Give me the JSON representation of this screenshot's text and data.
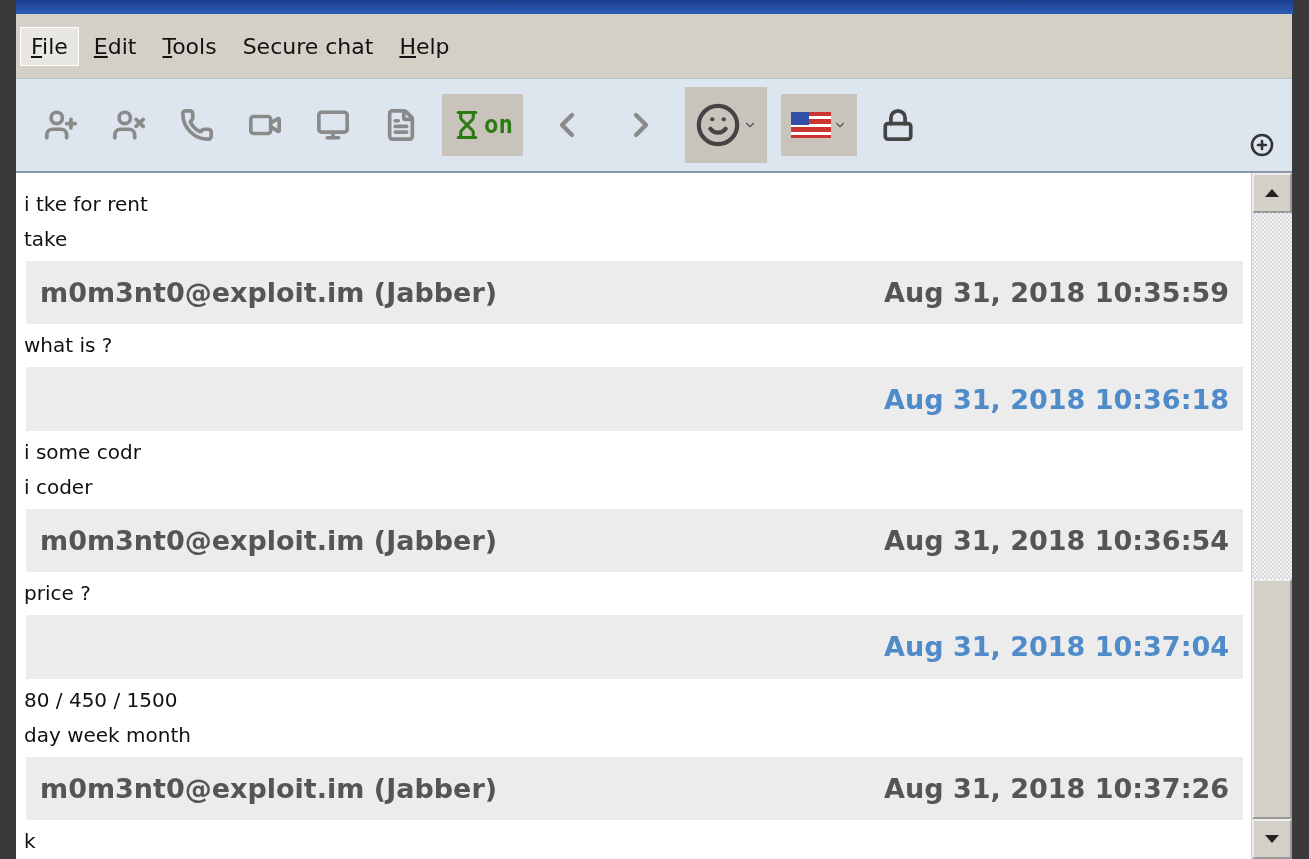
{
  "menu": [
    {
      "label": "File",
      "mnemonic": true,
      "selected": true
    },
    {
      "label": "Edit",
      "mnemonic": true,
      "selected": false
    },
    {
      "label": "Tools",
      "mnemonic": true,
      "selected": false
    },
    {
      "label": "Secure chat",
      "mnemonic": false,
      "selected": false
    },
    {
      "label": "Help",
      "mnemonic": true,
      "selected": false
    }
  ],
  "toolbar": [
    {
      "kind": "add-contact",
      "highlighted": false
    },
    {
      "kind": "remove-contact",
      "highlighted": false
    },
    {
      "kind": "call",
      "highlighted": false
    },
    {
      "kind": "video",
      "highlighted": false
    },
    {
      "kind": "screen",
      "highlighted": false
    },
    {
      "kind": "send-file",
      "highlighted": false
    },
    {
      "kind": "timer",
      "label": "on",
      "highlighted": true
    },
    {
      "kind": "back",
      "highlighted": false
    },
    {
      "kind": "forward",
      "highlighted": false
    },
    {
      "kind": "smiley",
      "highlighted": true
    },
    {
      "kind": "flag",
      "highlighted": true
    },
    {
      "kind": "lock",
      "highlighted": false
    }
  ],
  "messages": [
    {
      "kind": "text",
      "text": "i tke for rent"
    },
    {
      "kind": "text",
      "text": "take"
    },
    {
      "kind": "header",
      "sender": "m0m3nt0@exploit.im (Jabber)",
      "time": "Aug 31, 2018 10:35:59",
      "outgoing": false
    },
    {
      "kind": "text",
      "text": "what is ?"
    },
    {
      "kind": "header",
      "time": "Aug 31, 2018 10:36:18",
      "outgoing": true
    },
    {
      "kind": "text",
      "text": "i some codr"
    },
    {
      "kind": "text",
      "text": "i coder"
    },
    {
      "kind": "header",
      "sender": "m0m3nt0@exploit.im (Jabber)",
      "time": "Aug 31, 2018 10:36:54",
      "outgoing": false
    },
    {
      "kind": "text",
      "text": "price ?"
    },
    {
      "kind": "header",
      "time": "Aug 31, 2018 10:37:04",
      "outgoing": true
    },
    {
      "kind": "text",
      "text": "80 / 450 / 1500"
    },
    {
      "kind": "text",
      "text": "day week month"
    },
    {
      "kind": "header",
      "sender": "m0m3nt0@exploit.im (Jabber)",
      "time": "Aug 31, 2018 10:37:26",
      "outgoing": false
    },
    {
      "kind": "text",
      "text": "k"
    }
  ]
}
